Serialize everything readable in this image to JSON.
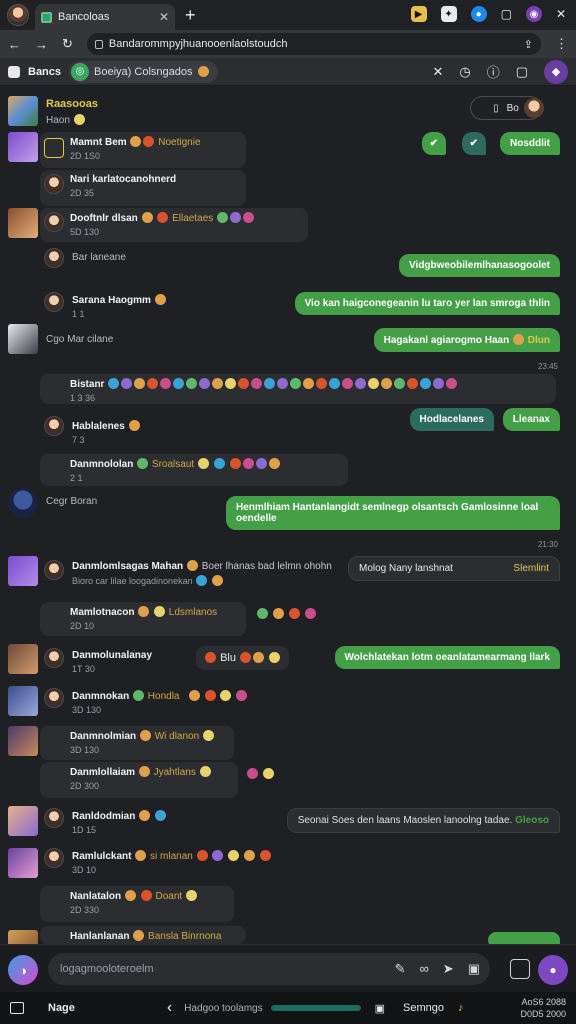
{
  "browser": {
    "tab_title": "Bancoloas",
    "url": "Bandarommpyjhuanooenlaolstoudch"
  },
  "channel": {
    "name": "Bancs",
    "pill_label": "Boeiya) Colsngados",
    "colors": {
      "accent": "#43a047",
      "purple": "#6b3fa0"
    }
  },
  "pinned": {
    "title": "Raasooas",
    "subtitle": "Haon",
    "button_label": "Bo"
  },
  "messages": [
    {
      "id": "m1",
      "name": "Mamnt Bem",
      "badge": "Noetignie",
      "meta": "2D 1S0"
    },
    {
      "id": "m2",
      "name": "Nari karlatocanohnerd",
      "meta": "2D 35"
    },
    {
      "id": "m3",
      "name": "Dooftnlr dlsan",
      "badge": "Ellaetaes",
      "meta": "5D 130"
    },
    {
      "id": "m4",
      "name": "Bar laneane",
      "meta": ""
    },
    {
      "id": "m5",
      "name": "Sarana Haogmm",
      "meta": "1 1"
    },
    {
      "id": "m6",
      "name": "Cgo Mar cilane",
      "meta": ""
    },
    {
      "id": "m7",
      "name": "Bistanr",
      "meta": "1 3 36"
    },
    {
      "id": "m8",
      "name": "Hablalenes",
      "meta": "7 3"
    },
    {
      "id": "m9",
      "name": "Danmnololan",
      "badge": "Sroalsaut",
      "meta": "2 1"
    },
    {
      "id": "m10",
      "name": "Cegr Boran",
      "meta": ""
    },
    {
      "id": "m11",
      "name": "Danmlomlsagas Mahan",
      "badge": "Boer lhanas bad lelmn ohohn",
      "meta": "Bioro car lilae loogadinonekan"
    },
    {
      "id": "m12",
      "name": "Mamlotnacon",
      "badge": "Ldsmlanos",
      "meta": "2D 10"
    },
    {
      "id": "m13",
      "name": "Danmolunalanay",
      "meta": "1T 30"
    },
    {
      "id": "m14",
      "name": "Danmnokan",
      "badge": "Hondla",
      "meta": "3D 130"
    },
    {
      "id": "m15",
      "name": "Danmnolmian",
      "badge": "Wi dlanon",
      "meta": "3D 130"
    },
    {
      "id": "m16",
      "name": "Danmlollaiam",
      "badge": "Jyahtlans",
      "meta": "2D 300"
    },
    {
      "id": "m17",
      "name": "Ranldodmian",
      "meta": "1D 15"
    },
    {
      "id": "m18",
      "name": "Ramlulckant",
      "badge": "si mlanan",
      "meta": "3D 10"
    },
    {
      "id": "m19",
      "name": "Nanlatalon",
      "badge": "Doant",
      "meta": "2D 330"
    },
    {
      "id": "m20",
      "name": "Hanlanlanan",
      "badge": "Bansla Binrnona",
      "meta": ""
    }
  ],
  "outgoing": [
    {
      "id": "o1",
      "text": "Nosddlit",
      "time": ""
    },
    {
      "id": "o2",
      "text": "Vidgbweobilemlhanasogoolet",
      "time": ""
    },
    {
      "id": "o3",
      "text": "Vio kan haigconegeanin lu taro yer lan smroga thlin",
      "time": ""
    },
    {
      "id": "o4",
      "text": "Hagakanl agiarogmo Haan",
      "suffix": "Dlun",
      "time": "23:45"
    },
    {
      "id": "o5",
      "text": "Hodlacelanes",
      "suffix": "Lleanax",
      "time": ""
    },
    {
      "id": "o6",
      "text": "Henmlhiam Hantanlangidt semlnegp olsantsch Gamlosinne loal oendelle",
      "time": "21:30"
    },
    {
      "id": "o7",
      "text": "Molog Nany lanshnat",
      "suffix": "Slemlint",
      "time": ""
    },
    {
      "id": "o8",
      "text": "Wolchlatekan lotm oeanlatamearmang llark",
      "time": ""
    },
    {
      "id": "o9",
      "text": "Seonai Soes den laans Maoslen lanoolng tadae.",
      "suffix": "Gleoso",
      "time": ""
    }
  ],
  "composer": {
    "placeholder": "logagmooloteroelm"
  },
  "bottomnav": {
    "label": "Nage",
    "mid_label": "Hadgoo toolamgs",
    "right_label": "Semngo",
    "right_top": "AoS6  2088",
    "right_bottom": "D0D5  2000"
  }
}
